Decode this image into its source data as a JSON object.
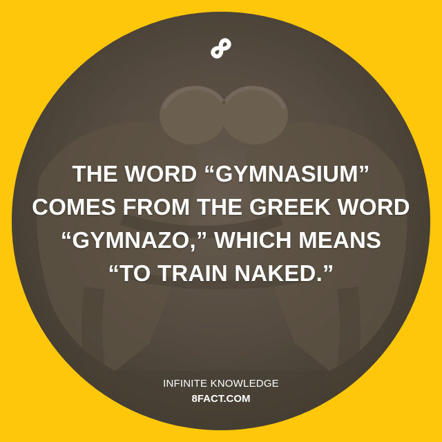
{
  "background": {
    "color": "#FFC709",
    "disc_color": "#5c5245"
  },
  "image": {
    "subject": "carved stone relief of two wrestlers"
  },
  "logo": {
    "icon": "infinity-eight-icon"
  },
  "fact": {
    "lines": [
      "THE WORD “GYMNASIUM”",
      "COMES FROM THE GREEK WORD",
      "“GYMNAZO,” WHICH MEANS",
      "“TO TRAIN NAKED.”"
    ]
  },
  "footer": {
    "tagline": "INFINITE KNOWLEDGE",
    "site": "8FACT.COM"
  }
}
